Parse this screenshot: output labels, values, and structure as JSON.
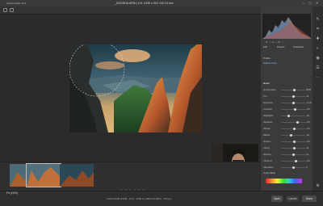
{
  "window": {
    "app_title": "Camera Raw 13.3",
    "doc_title": "_DSC8518.ARW  |  f/11  1/250 s  ISO 100  24 mm",
    "controls": [
      "—",
      "▢",
      "✕"
    ]
  },
  "toolbar": {
    "tools": [
      "zoom-icon",
      "hand-icon",
      "white-balance-icon",
      "color-sampler-icon",
      "crop-icon",
      "straighten-icon",
      "spot-removal-icon",
      "red-eye-icon",
      "adjustment-brush-icon",
      "graduated-filter-icon",
      "radial-filter-icon"
    ]
  },
  "histogram": {
    "values": "R: ---   G: ---   B: ---"
  },
  "panel": {
    "tabs": [
      "Edit",
      "Presets",
      "Snapshots"
    ],
    "profile_label": "Profile",
    "profile_value": "Adobe Color",
    "section_title": "Basic",
    "sliders": [
      {
        "label": "Temperature",
        "value": "6500",
        "level": 0.55
      },
      {
        "label": "Tint",
        "value": "+8",
        "level": 0.53
      },
      {
        "label": "Exposure",
        "value": "+0.25",
        "level": 0.52
      },
      {
        "label": "Contrast",
        "value": "+15",
        "level": 0.58
      },
      {
        "label": "Highlights",
        "value": "-45",
        "level": 0.3
      },
      {
        "label": "Shadows",
        "value": "+35",
        "level": 0.68
      },
      {
        "label": "Whites",
        "value": "+12",
        "level": 0.56
      },
      {
        "label": "Blacks",
        "value": "-18",
        "level": 0.42
      },
      {
        "label": "Texture",
        "value": "+10",
        "level": 0.55
      },
      {
        "label": "Clarity",
        "value": "+8",
        "level": 0.54
      },
      {
        "label": "Dehaze",
        "value": "+5",
        "level": 0.52
      },
      {
        "label": "Vibrance",
        "value": "+20",
        "level": 0.6
      },
      {
        "label": "Saturation",
        "value": "0",
        "level": 0.5
      }
    ],
    "hsl_label": "Color Mixer"
  },
  "filmstrip": {
    "thumbs": 4,
    "selected": 1
  },
  "status": {
    "zoom": "Fit (20%)",
    "info": "Adobe RGB (1998) - 8 bit - 6000 by 4000 (24.0MP) - 300 ppi",
    "pager": "○ ○ ○ ○ ○ ○"
  },
  "buttons": {
    "open": "Open",
    "cancel": "Cancel",
    "done": "Done"
  },
  "colors": {
    "accent": "#e8913a",
    "panel_bg": "#3b3b3b",
    "workspace_bg": "#2b2b2b"
  }
}
